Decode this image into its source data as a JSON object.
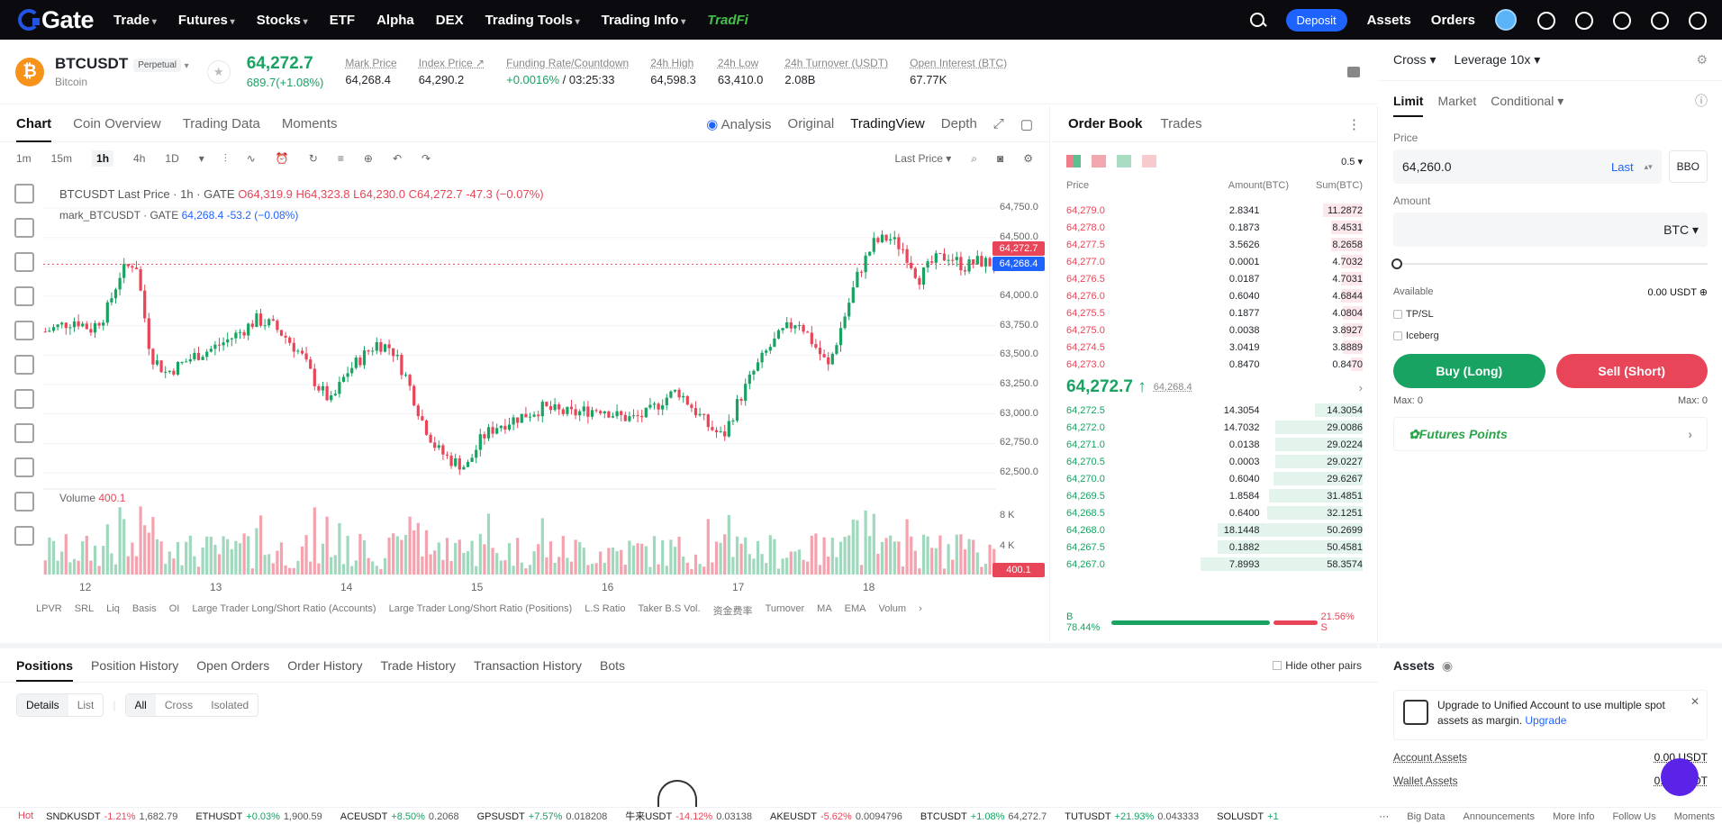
{
  "nav": {
    "logo": "Gate",
    "items": [
      "Trade",
      "Futures",
      "Stocks",
      "ETF",
      "Alpha",
      "DEX",
      "Trading Tools",
      "Trading Info"
    ],
    "tradfi": "TradFi",
    "deposit": "Deposit",
    "assets": "Assets",
    "orders": "Orders"
  },
  "ticker": {
    "symbol": "BTCUSDT",
    "badge": "Perpetual",
    "coin": "Bitcoin",
    "last_price": "64,272.7",
    "change": "689.7(+1.08%)",
    "stats": [
      {
        "k": "Mark Price",
        "v": "64,268.4"
      },
      {
        "k": "Index Price ↗",
        "v": "64,290.2"
      },
      {
        "k": "Funding Rate/Countdown",
        "v": "/ 03:25:33",
        "v_green": "+0.0016%"
      },
      {
        "k": "24h High",
        "v": "64,598.3"
      },
      {
        "k": "24h Low",
        "v": "63,410.0"
      },
      {
        "k": "24h Turnover (USDT)",
        "v": "2.08B"
      },
      {
        "k": "Open Interest (BTC)",
        "v": "67.77K"
      }
    ]
  },
  "chart_tabs": {
    "items": [
      "Chart",
      "Coin Overview",
      "Trading Data",
      "Moments"
    ],
    "analysis": "Analysis",
    "original": "Original",
    "tradingview": "TradingView",
    "depth": "Depth"
  },
  "timeframes": [
    "1m",
    "15m",
    "1h",
    "4h",
    "1D"
  ],
  "last_price_sel": "Last Price",
  "ohlc": {
    "title": "BTCUSDT Last Price · 1h · GATE",
    "o": "O64,319.9",
    "h": "H64,323.8",
    "l": "L64,230.0",
    "c": "C64,272.7 -47.3 (−0.07%)",
    "mark": "mark_BTCUSDT · GATE",
    "mark_v": "64,268.4 -53.2 (−0.08%)"
  },
  "volume": {
    "label": "Volume",
    "value": "400.1"
  },
  "indicators": [
    "LPVR",
    "SRL",
    "Liq",
    "Basis",
    "OI",
    "Large Trader Long/Short Ratio (Accounts)",
    "Large Trader Long/Short Ratio (Positions)",
    "L.S Ratio",
    "Taker B.S Vol.",
    "资金费率",
    "Turnover",
    "MA",
    "EMA",
    "Volum"
  ],
  "chart_data": {
    "type": "candlestick",
    "x_labels": [
      "12",
      "13",
      "14",
      "15",
      "16",
      "17",
      "18"
    ],
    "y_ticks": [
      "64,750.0",
      "64,500.0",
      "64,250.0",
      "64,000.0",
      "63,750.0",
      "63,500.0",
      "63,250.0",
      "63,000.0",
      "62,750.0",
      "62,500.0"
    ],
    "vol_ticks": [
      "8 K",
      "4 K"
    ],
    "price_badge": "64,272.7",
    "mark_badge": "64,268.4",
    "vol_badge": "400.1",
    "up_color": "#18a362",
    "down_color": "#e84558",
    "closes": [
      63700,
      63750,
      63800,
      63720,
      63850,
      64200,
      64300,
      63500,
      63350,
      63420,
      63500,
      63550,
      63620,
      63700,
      63800,
      63760,
      63650,
      63500,
      63250,
      63100,
      63350,
      63480,
      63600,
      63560,
      63300,
      62950,
      62700,
      62600,
      62550,
      62800,
      62900,
      62950,
      63000,
      63050,
      63020,
      63000,
      63030,
      63050,
      62980,
      62960,
      63000,
      63120,
      63200,
      63050,
      62900,
      62800,
      63100,
      63350,
      63550,
      63700,
      63800,
      63600,
      63400,
      63800,
      64200,
      64450,
      64500,
      64400,
      64150,
      64300,
      64350,
      64250,
      64300,
      64272
    ]
  },
  "book": {
    "tabs": [
      "Order Book",
      "Trades"
    ],
    "precision": "0.5",
    "cols": [
      "Price",
      "Amount(BTC)",
      "Sum(BTC)"
    ],
    "asks": [
      [
        "64,279.0",
        "2.8341",
        "11.2872"
      ],
      [
        "64,278.0",
        "0.1873",
        "8.4531"
      ],
      [
        "64,277.5",
        "3.5626",
        "8.2658"
      ],
      [
        "64,277.0",
        "0.0001",
        "4.7032"
      ],
      [
        "64,276.5",
        "0.0187",
        "4.7031"
      ],
      [
        "64,276.0",
        "0.6040",
        "4.6844"
      ],
      [
        "64,275.5",
        "0.1877",
        "4.0804"
      ],
      [
        "64,275.0",
        "0.0038",
        "3.8927"
      ],
      [
        "64,274.5",
        "3.0419",
        "3.8889"
      ],
      [
        "64,273.0",
        "0.8470",
        "0.8470"
      ]
    ],
    "mid_price": "64,272.7 ↑",
    "mid_mark": "64,268.4",
    "bids": [
      [
        "64,272.5",
        "14.3054",
        "14.3054"
      ],
      [
        "64,272.0",
        "14.7032",
        "29.0086"
      ],
      [
        "64,271.0",
        "0.0138",
        "29.0224"
      ],
      [
        "64,270.5",
        "0.0003",
        "29.0227"
      ],
      [
        "64,270.0",
        "0.6040",
        "29.6267"
      ],
      [
        "64,269.5",
        "1.8584",
        "31.4851"
      ],
      [
        "64,268.5",
        "0.6400",
        "32.1251"
      ],
      [
        "64,268.0",
        "18.1448",
        "50.2699"
      ],
      [
        "64,267.5",
        "0.1882",
        "50.4581"
      ],
      [
        "64,267.0",
        "7.8993",
        "58.3574"
      ]
    ],
    "buy_ratio": "B 78.44%",
    "sell_ratio": "21.56% S",
    "buy_fraction": 0.7844
  },
  "order": {
    "margin": "Cross",
    "leverage": "Leverage 10x",
    "types": [
      "Limit",
      "Market",
      "Conditional"
    ],
    "price_label": "Price",
    "price": "64,260.0",
    "last": "Last",
    "bbo": "BBO",
    "amount_label": "Amount",
    "unit": "BTC",
    "available_label": "Available",
    "available": "0.00 USDT",
    "tpsl": "TP/SL",
    "iceberg": "Iceberg",
    "buy": "Buy (Long)",
    "sell": "Sell (Short)",
    "max_l": "Max: 0",
    "max_r": "Max: 0",
    "points": "Futures Points"
  },
  "bottom": {
    "tabs": [
      "Positions",
      "Position History",
      "Open Orders",
      "Order History",
      "Trade History",
      "Transaction History",
      "Bots"
    ],
    "hide": "Hide other pairs",
    "view": [
      "Details",
      "List"
    ],
    "filter": [
      "All",
      "Cross",
      "Isolated"
    ]
  },
  "assets": {
    "title": "Assets",
    "upgrade": "Upgrade to Unified Account to use multiple spot assets as margin.",
    "upgrade_link": "Upgrade",
    "account": "Account Assets",
    "account_v": "0.00 USDT",
    "wallet": "Wallet Assets",
    "wallet_v": "0.00 USDT"
  },
  "footer": {
    "hot": "Hot",
    "tickers": [
      [
        "SNDKUSDT",
        "-1.21%",
        "1,682.79",
        "down"
      ],
      [
        "ETHUSDT",
        "+0.03%",
        "1,900.59",
        "up"
      ],
      [
        "ACEUSDT",
        "+8.50%",
        "0.2068",
        "up"
      ],
      [
        "GPSUSDT",
        "+7.57%",
        "0.018208",
        "up"
      ],
      [
        "牛来USDT",
        "-14.12%",
        "0.03138",
        "down"
      ],
      [
        "AKEUSDT",
        "-5.62%",
        "0.0094796",
        "down"
      ],
      [
        "BTCUSDT",
        "+1.08%",
        "64,272.7",
        "up"
      ],
      [
        "TUTUSDT",
        "+21.93%",
        "0.043333",
        "up"
      ],
      [
        "SOLUSDT",
        "+1",
        "",
        "up"
      ]
    ],
    "links": [
      "Big Data",
      "Announcements",
      "More Info",
      "Follow Us",
      "Moments"
    ]
  }
}
